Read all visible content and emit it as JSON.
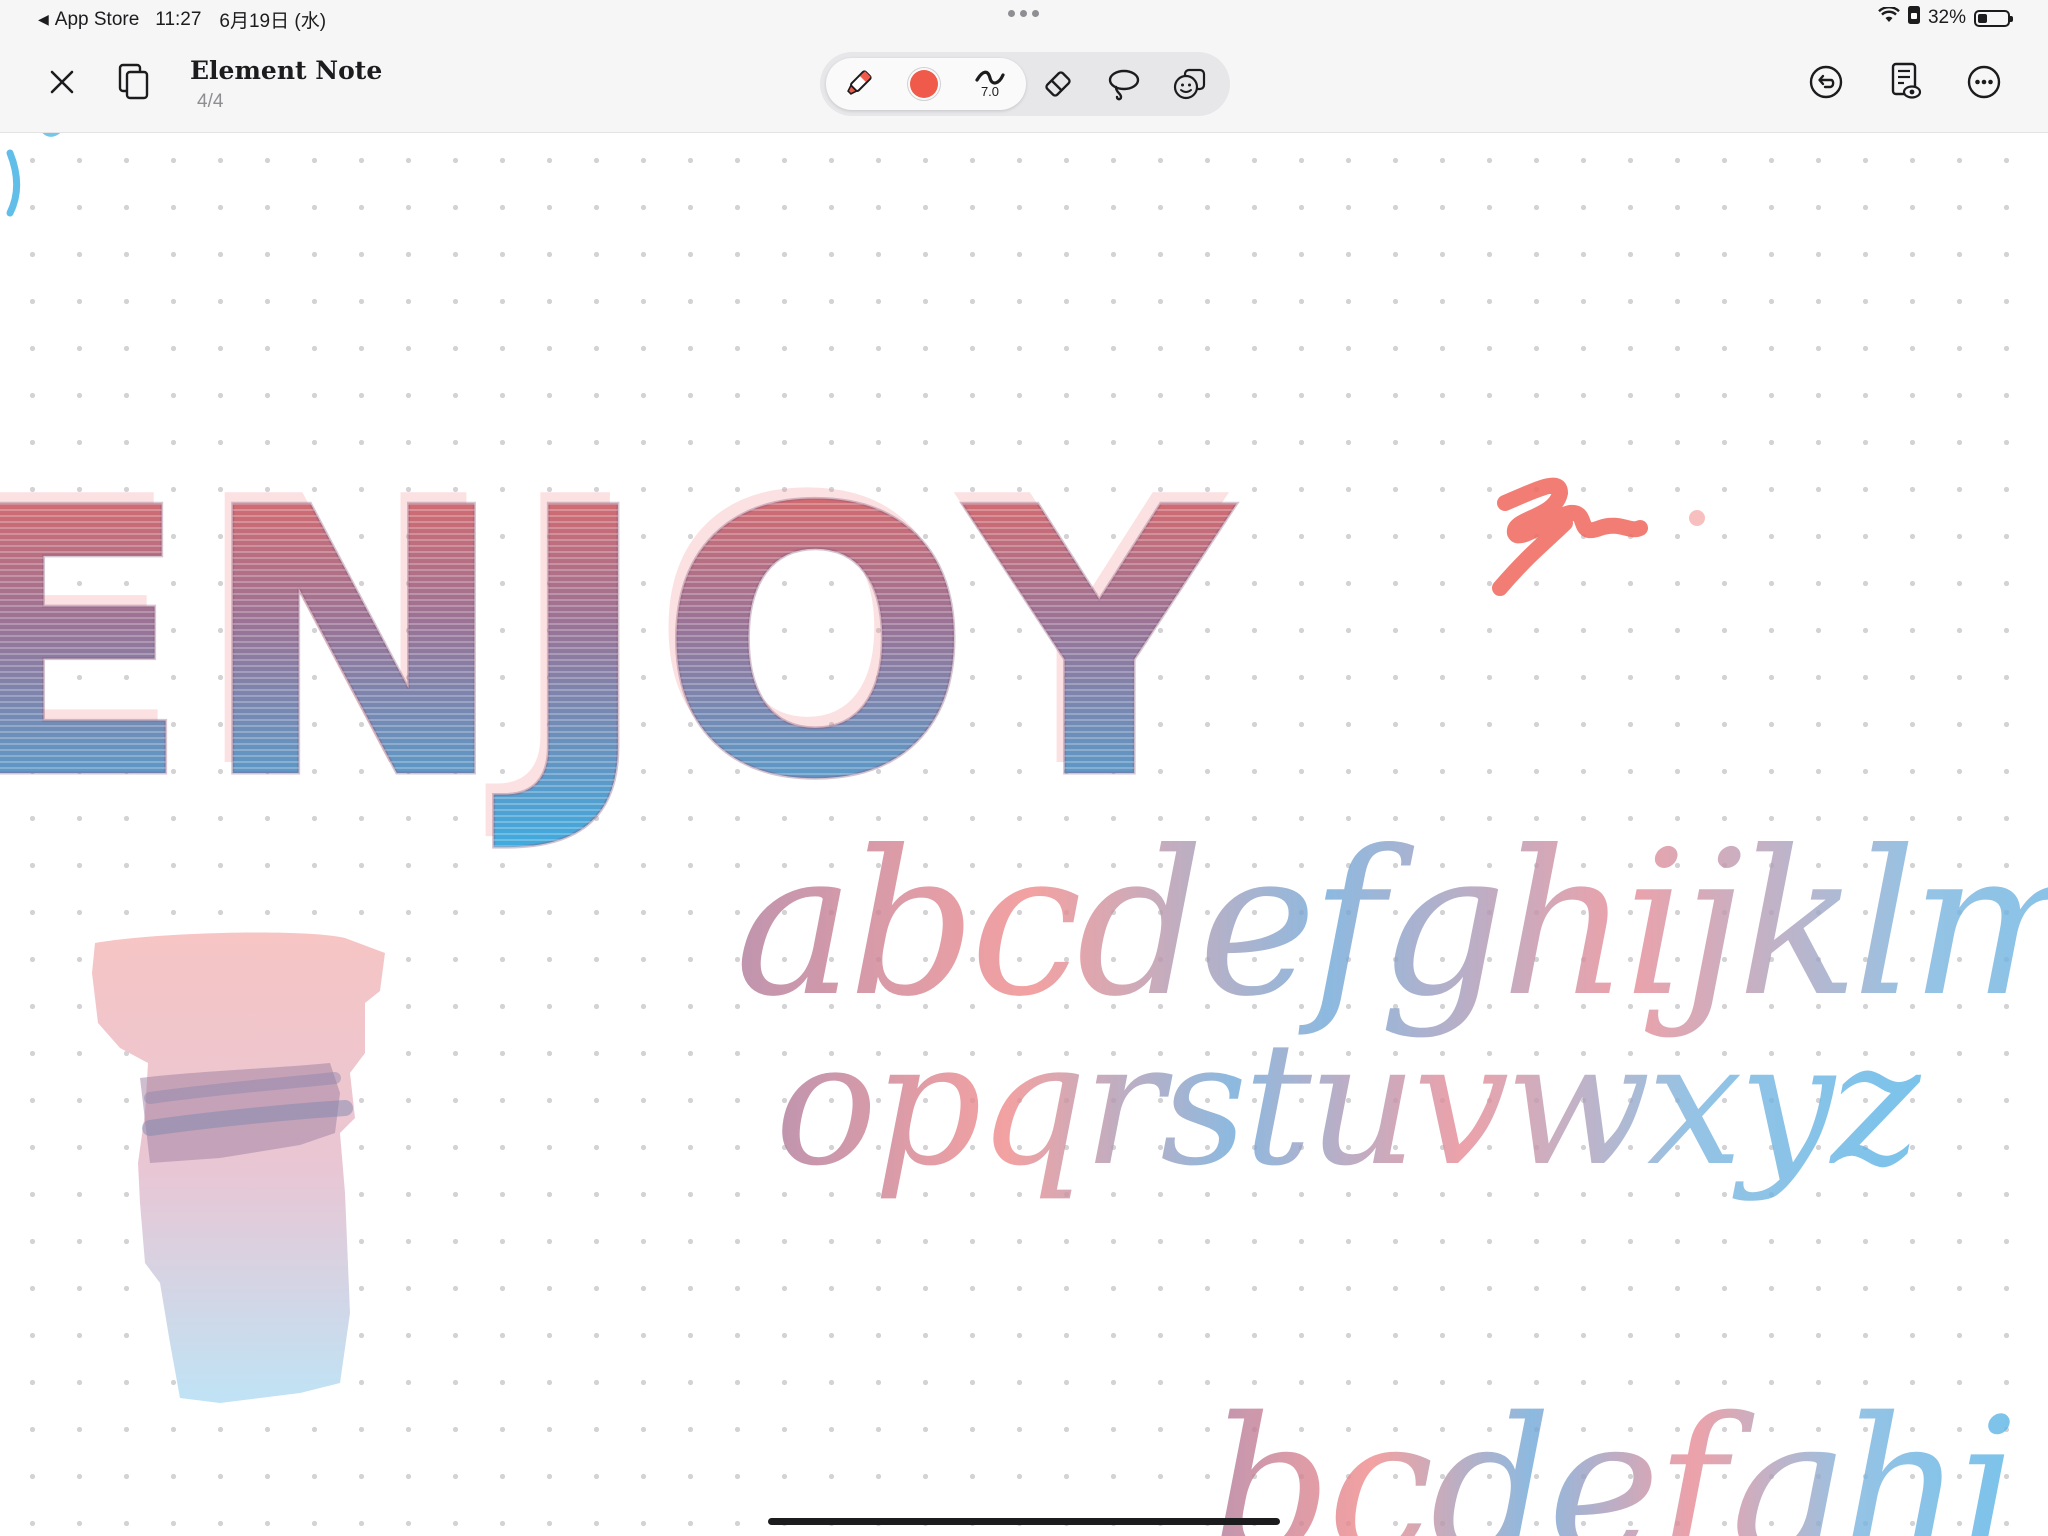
{
  "status_bar": {
    "back_label": "App Store",
    "time": "11:27",
    "date": "6月19日 (水)",
    "battery_percent": "32%",
    "battery_level": 0.32
  },
  "toolbar": {
    "title": "Element Note",
    "page_indicator": "4/4",
    "pen_color": "#f05a4a",
    "stroke_width": "7.0",
    "icons": [
      "close-icon",
      "pages-icon",
      "marker-icon",
      "color-icon",
      "stroke-width-icon",
      "eraser-icon",
      "lasso-icon",
      "sticker-icon",
      "undo-icon",
      "reader-icon",
      "more-icon"
    ]
  },
  "canvas": {
    "heading_text": "ENJOY",
    "alphabet_row1": "abcdefghijklmn",
    "alphabet_row2": "opqrstuvwxyz",
    "alphabet_row3": "bcdefghi",
    "colors": {
      "red": "#f0665c",
      "blue": "#3aaee3",
      "mauve": "#b07a9a"
    }
  }
}
